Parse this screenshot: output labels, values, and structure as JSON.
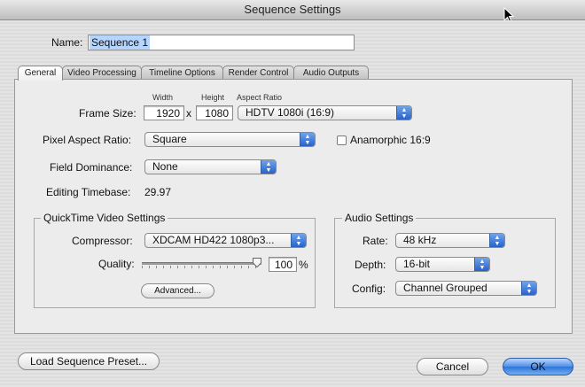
{
  "window": {
    "title": "Sequence Settings"
  },
  "name": {
    "label": "Name:",
    "value": "Sequence 1"
  },
  "tabs": [
    {
      "label": "General",
      "active": true
    },
    {
      "label": "Video Processing",
      "active": false
    },
    {
      "label": "Timeline Options",
      "active": false
    },
    {
      "label": "Render Control",
      "active": false
    },
    {
      "label": "Audio Outputs",
      "active": false
    }
  ],
  "general": {
    "col_width": "Width",
    "col_height": "Height",
    "col_aspect": "Aspect Ratio",
    "frame_size_label": "Frame Size:",
    "width_value": "1920",
    "times": "x",
    "height_value": "1080",
    "aspect_value": "HDTV 1080i (16:9)",
    "pixel_aspect_label": "Pixel Aspect Ratio:",
    "pixel_aspect_value": "Square",
    "anamorphic_label": "Anamorphic 16:9",
    "anamorphic_checked": false,
    "field_dominance_label": "Field Dominance:",
    "field_dominance_value": "None",
    "editing_timebase_label": "Editing Timebase:",
    "editing_timebase_value": "29.97"
  },
  "quicktime": {
    "title": "QuickTime Video Settings",
    "compressor_label": "Compressor:",
    "compressor_value": "XDCAM HD422 1080p3...",
    "quality_label": "Quality:",
    "quality_value": "100",
    "quality_unit": "%",
    "quality_level_percent": 100,
    "advanced_label": "Advanced..."
  },
  "audio": {
    "title": "Audio Settings",
    "rate_label": "Rate:",
    "rate_value": "48 kHz",
    "depth_label": "Depth:",
    "depth_value": "16-bit",
    "config_label": "Config:",
    "config_value": "Channel Grouped"
  },
  "footer": {
    "load_preset_label": "Load Sequence Preset...",
    "cancel_label": "Cancel",
    "ok_label": "OK"
  },
  "colors": {
    "accent": "#2f74d8",
    "selection": "#b5d5ff"
  }
}
